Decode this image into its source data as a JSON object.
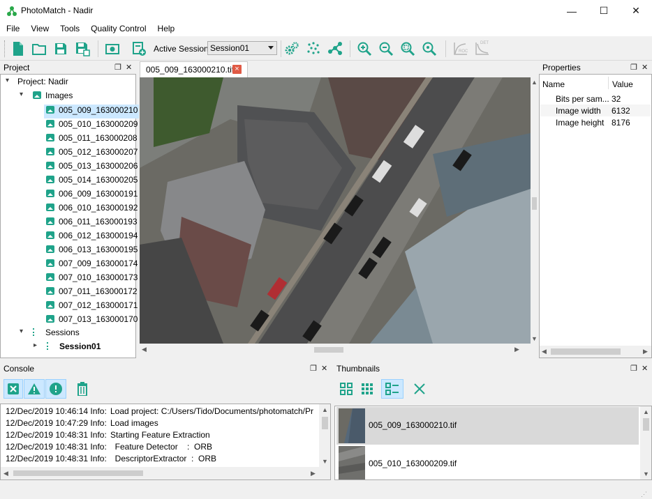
{
  "window": {
    "title": "PhotoMatch - Nadir",
    "minimize": "—",
    "maximize": "☐",
    "close": "✕"
  },
  "menu": [
    "File",
    "View",
    "Tools",
    "Quality Control",
    "Help"
  ],
  "toolbar": {
    "session_label": "Active Session:",
    "session_value": "Session01",
    "buttons": [
      "new-project",
      "open-project",
      "save-project",
      "save-as",
      "load-images",
      "new-session",
      "feature-extraction",
      "keypoints",
      "matching",
      "zoom-in",
      "zoom-out",
      "zoom-extent",
      "zoom-fit",
      "roc-curve",
      "det-curve"
    ],
    "roc": "ROC",
    "det": "DET"
  },
  "project_panel": {
    "title": "Project",
    "root": "Project: Nadir",
    "images_label": "Images",
    "images": [
      "005_009_163000210",
      "005_010_163000209",
      "005_011_163000208",
      "005_012_163000207",
      "005_013_163000206",
      "005_014_163000205",
      "006_009_163000191",
      "006_010_163000192",
      "006_011_163000193",
      "006_012_163000194",
      "006_013_163000195",
      "007_009_163000174",
      "007_010_163000173",
      "007_011_163000172",
      "007_012_163000171",
      "007_013_163000170"
    ],
    "selected_index": 0,
    "sessions_label": "Sessions",
    "session": "Session01"
  },
  "viewer": {
    "tab_label": "005_009_163000210.tif",
    "tab_close": "×"
  },
  "properties_panel": {
    "title": "Properties",
    "col_name": "Name",
    "col_value": "Value",
    "rows": [
      {
        "name": "Bits per sam...",
        "value": "32"
      },
      {
        "name": "Image width",
        "value": "6132"
      },
      {
        "name": "Image height",
        "value": "8176"
      }
    ]
  },
  "console_panel": {
    "title": "Console",
    "log": [
      {
        "ts": "12/Dec/2019 10:46:14 Info:",
        "msg": "Load project: C:/Users/Tido/Documents/photomatch/Pr"
      },
      {
        "ts": "12/Dec/2019 10:47:29 Info:",
        "msg": "Load images"
      },
      {
        "ts": "12/Dec/2019 10:48:31 Info:",
        "msg": "Starting Feature Extraction"
      },
      {
        "ts": "12/Dec/2019 10:48:31 Info:",
        "msg": "  Feature Detector    :  ORB"
      },
      {
        "ts": "12/Dec/2019 10:48:31 Info:",
        "msg": "  DescriptorExtractor  :  ORB"
      }
    ]
  },
  "thumbnails_panel": {
    "title": "Thumbnails",
    "items": [
      "005_009_163000210.tif",
      "005_010_163000209.tif"
    ]
  },
  "colors": {
    "accent": "#1fa38a",
    "selection": "#cce8ff",
    "delete_red": "#e05a45"
  }
}
